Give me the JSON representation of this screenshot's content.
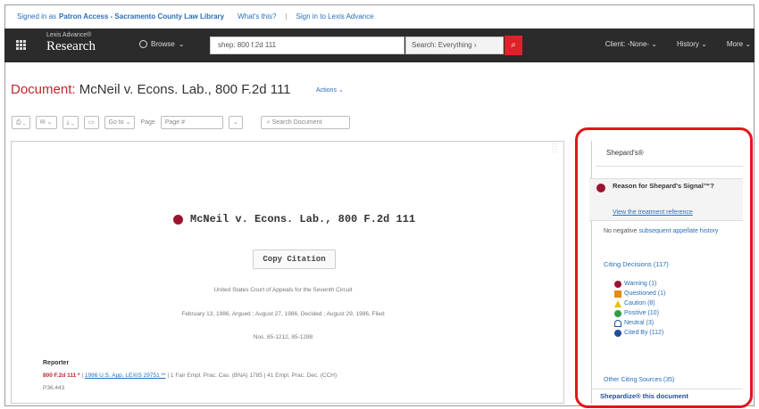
{
  "signin": {
    "prefix": "Signed in as",
    "org": "Patron Access - Sacramento County Law Library",
    "whats_this": "What's this?",
    "signin_link": "Sign in to Lexis Advance"
  },
  "header": {
    "brand_small": "Lexis Advance®",
    "brand_big": "Research",
    "browse": "Browse",
    "search_value": "shep: 800 f.2d 111",
    "search_type": "Search: Everything",
    "client": "Client: -None-",
    "history": "History",
    "more": "More"
  },
  "document": {
    "title_label": "Document:",
    "title": "McNeil v. Econs. Lab., 800 F.2d 111",
    "actions": "Actions"
  },
  "toolbar": {
    "go_to": "Go to",
    "page": "Page",
    "page_value": "Page #",
    "search_doc": "Search Document"
  },
  "case": {
    "title": "McNeil v. Econs. Lab., 800 F.2d 111",
    "copy_citation": "Copy Citation",
    "court": "United States Court of Appeals for the Seventh Circuit",
    "dates": "February 13, 1986, Argued ; August 27, 1986, Decided ; August 29, 1986, Filed",
    "nos": "Nos. 85-1212, 85-1288",
    "reporter_label": "Reporter",
    "reporter_cite": "800 F.2d 111 *",
    "reporter_link": "1986 U.S. App. LEXIS 29751 **",
    "reporter_rest": " | 1 Fair Empl. Prac. Cas. (BNA) 1785 | 41 Empl. Prac. Dec. (CCH)",
    "reporter_line2": "P36,443"
  },
  "shepard": {
    "heading": "Shepard's®",
    "reason_title": "Reason for Shepard's Signal™?",
    "reason_link": "View the treatment reference",
    "negative_prefix": "No negative",
    "negative_link": "subsequent appellate history",
    "citing": "Citing Decisions (117)",
    "signals": [
      {
        "label": "Warning (1)",
        "icon": "warning"
      },
      {
        "label": "Questioned (1)",
        "icon": "questioned"
      },
      {
        "label": "Caution (8)",
        "icon": "caution"
      },
      {
        "label": "Positive (10)",
        "icon": "positive"
      },
      {
        "label": "Neutral (3)",
        "icon": "neutral"
      },
      {
        "label": "Cited By (112)",
        "icon": "cited-by"
      }
    ],
    "other_sources": "Other Citing Sources (35)",
    "shepardize": "Shepardize® this document"
  }
}
